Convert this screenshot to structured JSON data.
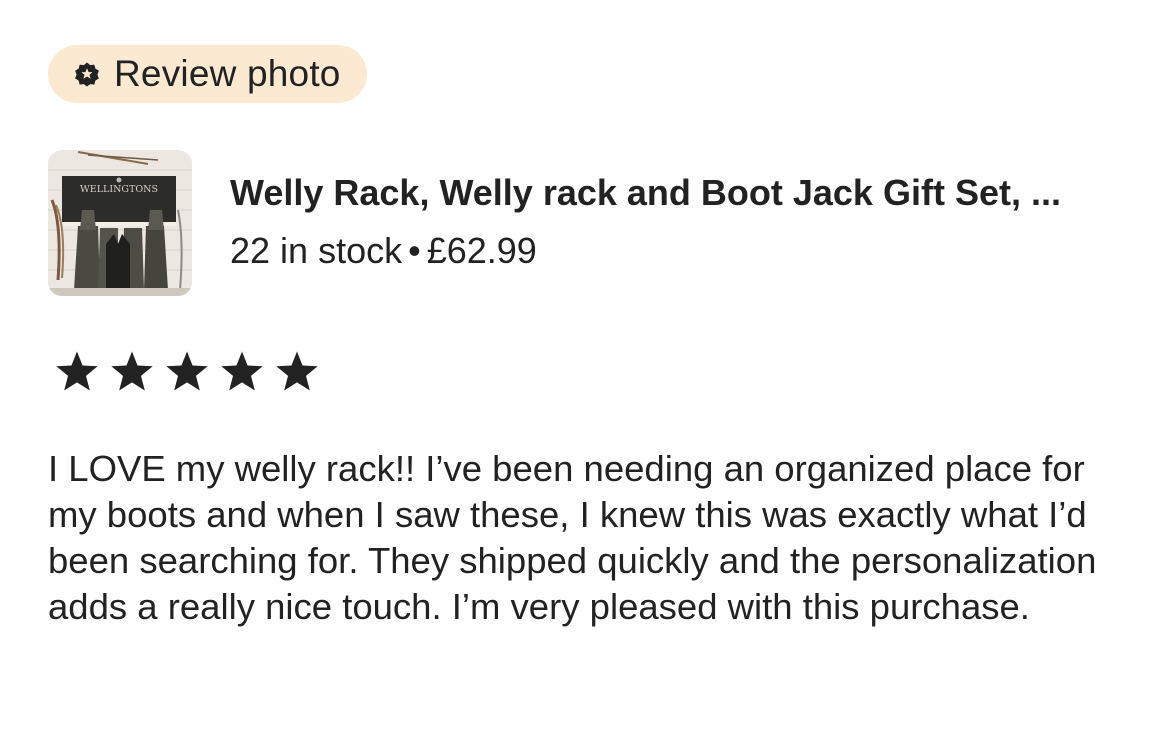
{
  "badge": {
    "icon": "star-badge-icon",
    "label": "Review photo",
    "bg_color": "#fce9d2"
  },
  "listing": {
    "thumbnail_icon": "product-thumbnail",
    "thumbnail_sign_text": "WELLINGTONS",
    "title": "Welly Rack, Welly rack and Boot Jack Gift Set, ...",
    "stock": "22 in stock",
    "separator": "•",
    "price": "£62.99"
  },
  "rating": {
    "stars": 5,
    "max": 5,
    "icon": "star-icon",
    "color": "#222222"
  },
  "review": {
    "text": "I LOVE my welly rack!! I’ve been needing an organized place for my boots and when I saw these, I knew this was exactly what I’d been searching for. They shipped quickly and the personalization adds a really nice touch. I’m very pleased with this purchase."
  }
}
